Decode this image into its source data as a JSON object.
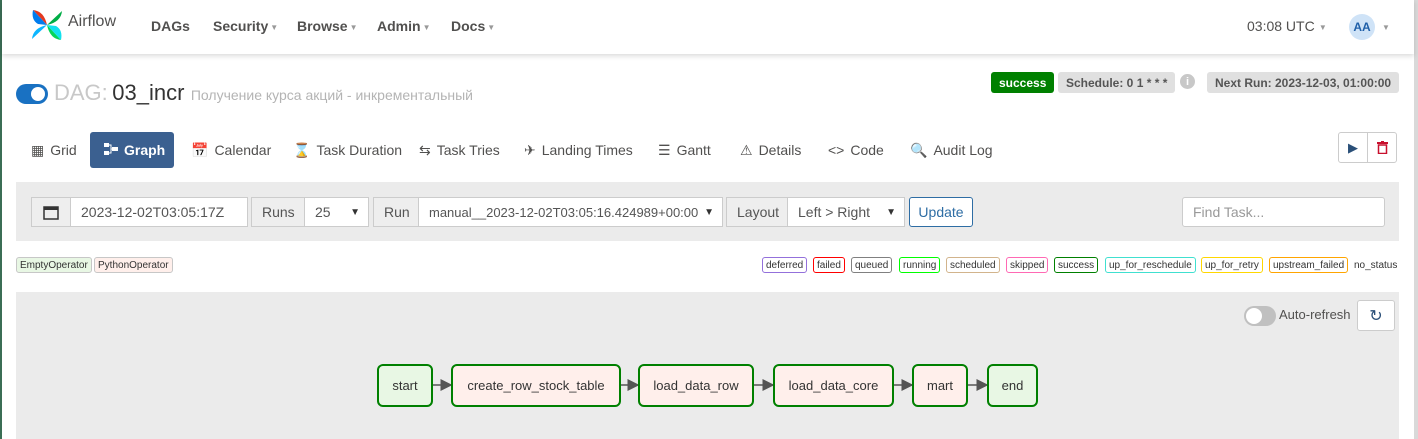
{
  "navbar": {
    "brand": "Airflow",
    "items": [
      {
        "label": "DAGs",
        "dropdown": false
      },
      {
        "label": "Security",
        "dropdown": true
      },
      {
        "label": "Browse",
        "dropdown": true
      },
      {
        "label": "Admin",
        "dropdown": true
      },
      {
        "label": "Docs",
        "dropdown": true
      }
    ],
    "time": "03:08 UTC",
    "avatar": "AA"
  },
  "dag": {
    "prefix": "DAG:",
    "id": "03_incr",
    "description": "Получение курса акций - инкрементальный",
    "paused": false,
    "status": "success",
    "schedule": "Schedule: 0 1 * * *",
    "next_run": "Next Run: 2023-12-03, 01:00:00"
  },
  "tabs": [
    {
      "label": "Grid",
      "icon": "grid-icon"
    },
    {
      "label": "Graph",
      "icon": "graph-icon",
      "active": true
    },
    {
      "label": "Calendar",
      "icon": "calendar-icon"
    },
    {
      "label": "Task Duration",
      "icon": "hourglass-icon"
    },
    {
      "label": "Task Tries",
      "icon": "retry-icon"
    },
    {
      "label": "Landing Times",
      "icon": "plane-landing-icon"
    },
    {
      "label": "Gantt",
      "icon": "gantt-icon"
    },
    {
      "label": "Details",
      "icon": "warning-triangle-icon"
    },
    {
      "label": "Code",
      "icon": "code-icon"
    },
    {
      "label": "Audit Log",
      "icon": "audit-search-icon"
    }
  ],
  "filters": {
    "base_date": "2023-12-02T03:05:17Z",
    "runs_label": "Runs",
    "runs_value": "25",
    "run_label": "Run",
    "run_value": "manual__2023-12-02T03:05:16.424989+00:00",
    "layout_label": "Layout",
    "layout_value": "Left > Right",
    "update_label": "Update",
    "find_task_placeholder": "Find Task..."
  },
  "operators": [
    "EmptyOperator",
    "PythonOperator"
  ],
  "states": [
    {
      "label": "deferred",
      "color": "#9370db"
    },
    {
      "label": "failed",
      "color": "#ff0000"
    },
    {
      "label": "queued",
      "color": "#808080"
    },
    {
      "label": "running",
      "color": "#00ff00"
    },
    {
      "label": "scheduled",
      "color": "#d2b48c"
    },
    {
      "label": "skipped",
      "color": "#ff69b4"
    },
    {
      "label": "success",
      "color": "#008000"
    },
    {
      "label": "up_for_reschedule",
      "color": "#40e0d0"
    },
    {
      "label": "up_for_retry",
      "color": "#ffd700"
    },
    {
      "label": "upstream_failed",
      "color": "#ffa500"
    },
    {
      "label": "no_status",
      "color": "#ffffff"
    }
  ],
  "graph": {
    "auto_refresh_label": "Auto-refresh",
    "auto_refresh": false,
    "tasks": [
      {
        "label": "start",
        "operator": "EmptyOperator",
        "state": "success"
      },
      {
        "label": "create_row_stock_table",
        "operator": "PythonOperator",
        "state": "success"
      },
      {
        "label": "load_data_row",
        "operator": "PythonOperator",
        "state": "success"
      },
      {
        "label": "load_data_core",
        "operator": "PythonOperator",
        "state": "success"
      },
      {
        "label": "mart",
        "operator": "PythonOperator",
        "state": "success"
      },
      {
        "label": "end",
        "operator": "EmptyOperator",
        "state": "success"
      }
    ]
  }
}
